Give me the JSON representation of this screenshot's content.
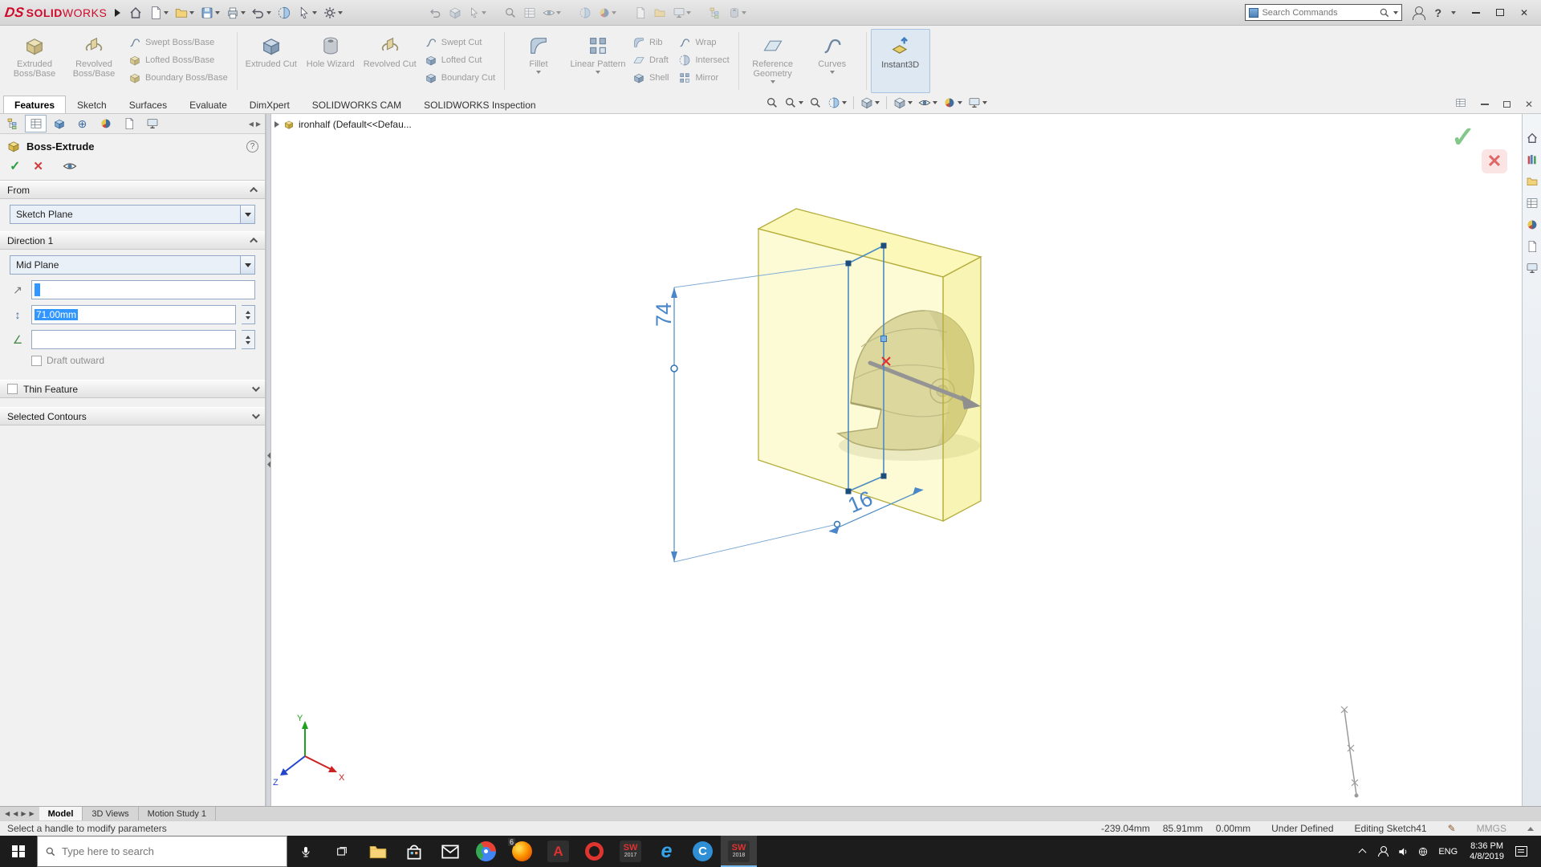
{
  "colors": {
    "brand_red": "#cf0a2c",
    "sketch_blue": "#4a86c8",
    "preview_yellow": "#f5ef85",
    "selection_blue": "#3196ff"
  },
  "titlebar": {
    "logo_ds": "DS",
    "logo_solid": "SOLID",
    "logo_works": "WORKS",
    "search_placeholder": "Search Commands"
  },
  "ribbon": {
    "extruded_boss": "Extruded Boss/Base",
    "revolved_boss": "Revolved Boss/Base",
    "swept_boss": "Swept Boss/Base",
    "lofted_boss": "Lofted Boss/Base",
    "boundary_boss": "Boundary Boss/Base",
    "extruded_cut": "Extruded Cut",
    "hole_wizard": "Hole Wizard",
    "revolved_cut": "Revolved Cut",
    "swept_cut": "Swept Cut",
    "lofted_cut": "Lofted Cut",
    "boundary_cut": "Boundary Cut",
    "fillet": "Fillet",
    "linear_pattern": "Linear Pattern",
    "rib": "Rib",
    "draft": "Draft",
    "shell": "Shell",
    "wrap": "Wrap",
    "intersect": "Intersect",
    "mirror": "Mirror",
    "reference_geometry": "Reference Geometry",
    "curves": "Curves",
    "instant3d": "Instant3D"
  },
  "command_tabs": {
    "features": "Features",
    "sketch": "Sketch",
    "surfaces": "Surfaces",
    "evaluate": "Evaluate",
    "dimxpert": "DimXpert",
    "cam": "SOLIDWORKS CAM",
    "inspection": "SOLIDWORKS Inspection"
  },
  "property_manager": {
    "title": "Boss-Extrude",
    "from_label": "From",
    "from_value": "Sketch Plane",
    "direction1_label": "Direction 1",
    "direction1_value": "Mid Plane",
    "depth_value": "71.00mm",
    "draft_outward_label": "Draft outward",
    "thin_feature_label": "Thin Feature",
    "selected_contours_label": "Selected Contours"
  },
  "feature_tree": {
    "breadcrumb": "ironhalf  (Default<<Defau..."
  },
  "viewport": {
    "dim_vertical": "74",
    "dim_horizontal": "16",
    "triad": {
      "x": "X",
      "y": "Y",
      "z": "Z"
    }
  },
  "document_tabs": {
    "model": "Model",
    "views_3d": "3D Views",
    "motion_study": "Motion Study 1"
  },
  "status_bar": {
    "message": "Select a handle to modify parameters",
    "coord_x": "-239.04mm",
    "coord_y": "85.91mm",
    "coord_z": "0.00mm",
    "definition_state": "Under Defined",
    "editing_state": "Editing Sketch41",
    "units": "MMGS"
  },
  "taskbar": {
    "search_placeholder": "Type here to search",
    "firefox_badge": "6",
    "sw_mark": "SW",
    "sw2017_year": "2017",
    "sw2018_year": "2018",
    "adobe_letter": "A",
    "opera_letter": "O",
    "edge_letter": "e",
    "c_letter": "C",
    "language": "ENG",
    "time": "8:36 PM",
    "date": "4/8/2019"
  }
}
